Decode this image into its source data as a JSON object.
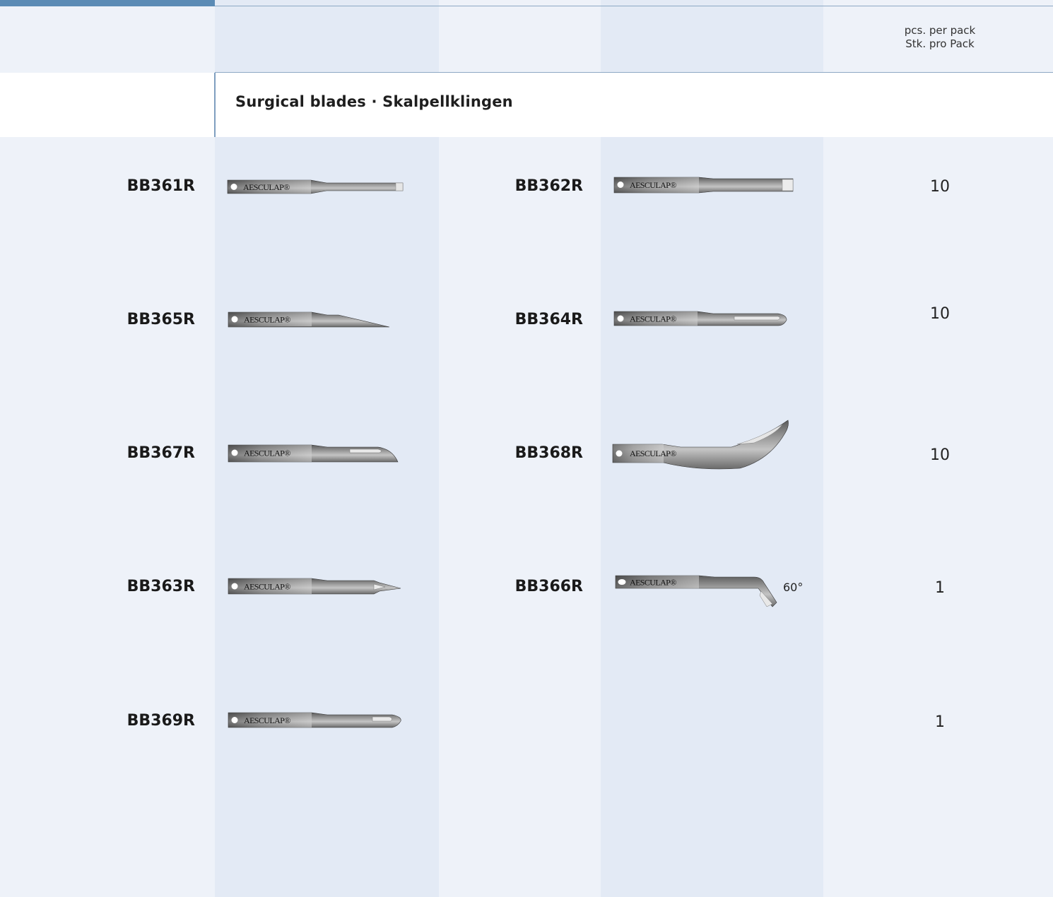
{
  "header": {
    "pcs_line1": "pcs. per pack",
    "pcs_line2": "Stk. pro Pack"
  },
  "section": {
    "title": "Surgical blades · Skalpellklingen"
  },
  "blade_brand": "AESCULAP®",
  "rows": [
    {
      "left_code": "BB361R",
      "right_code": "BB362R",
      "qty": "10"
    },
    {
      "left_code": "BB365R",
      "right_code": "BB364R",
      "qty": "10"
    },
    {
      "left_code": "BB367R",
      "right_code": "BB368R",
      "qty": "10"
    },
    {
      "left_code": "BB363R",
      "right_code": "BB366R",
      "qty": "1",
      "right_note": "60°"
    },
    {
      "left_code": "BB369R",
      "qty": "1"
    }
  ],
  "colors": {
    "top_accent": "#5b8bb5",
    "column_dark": "#e3eaf5",
    "column_light": "#eef2f9"
  }
}
